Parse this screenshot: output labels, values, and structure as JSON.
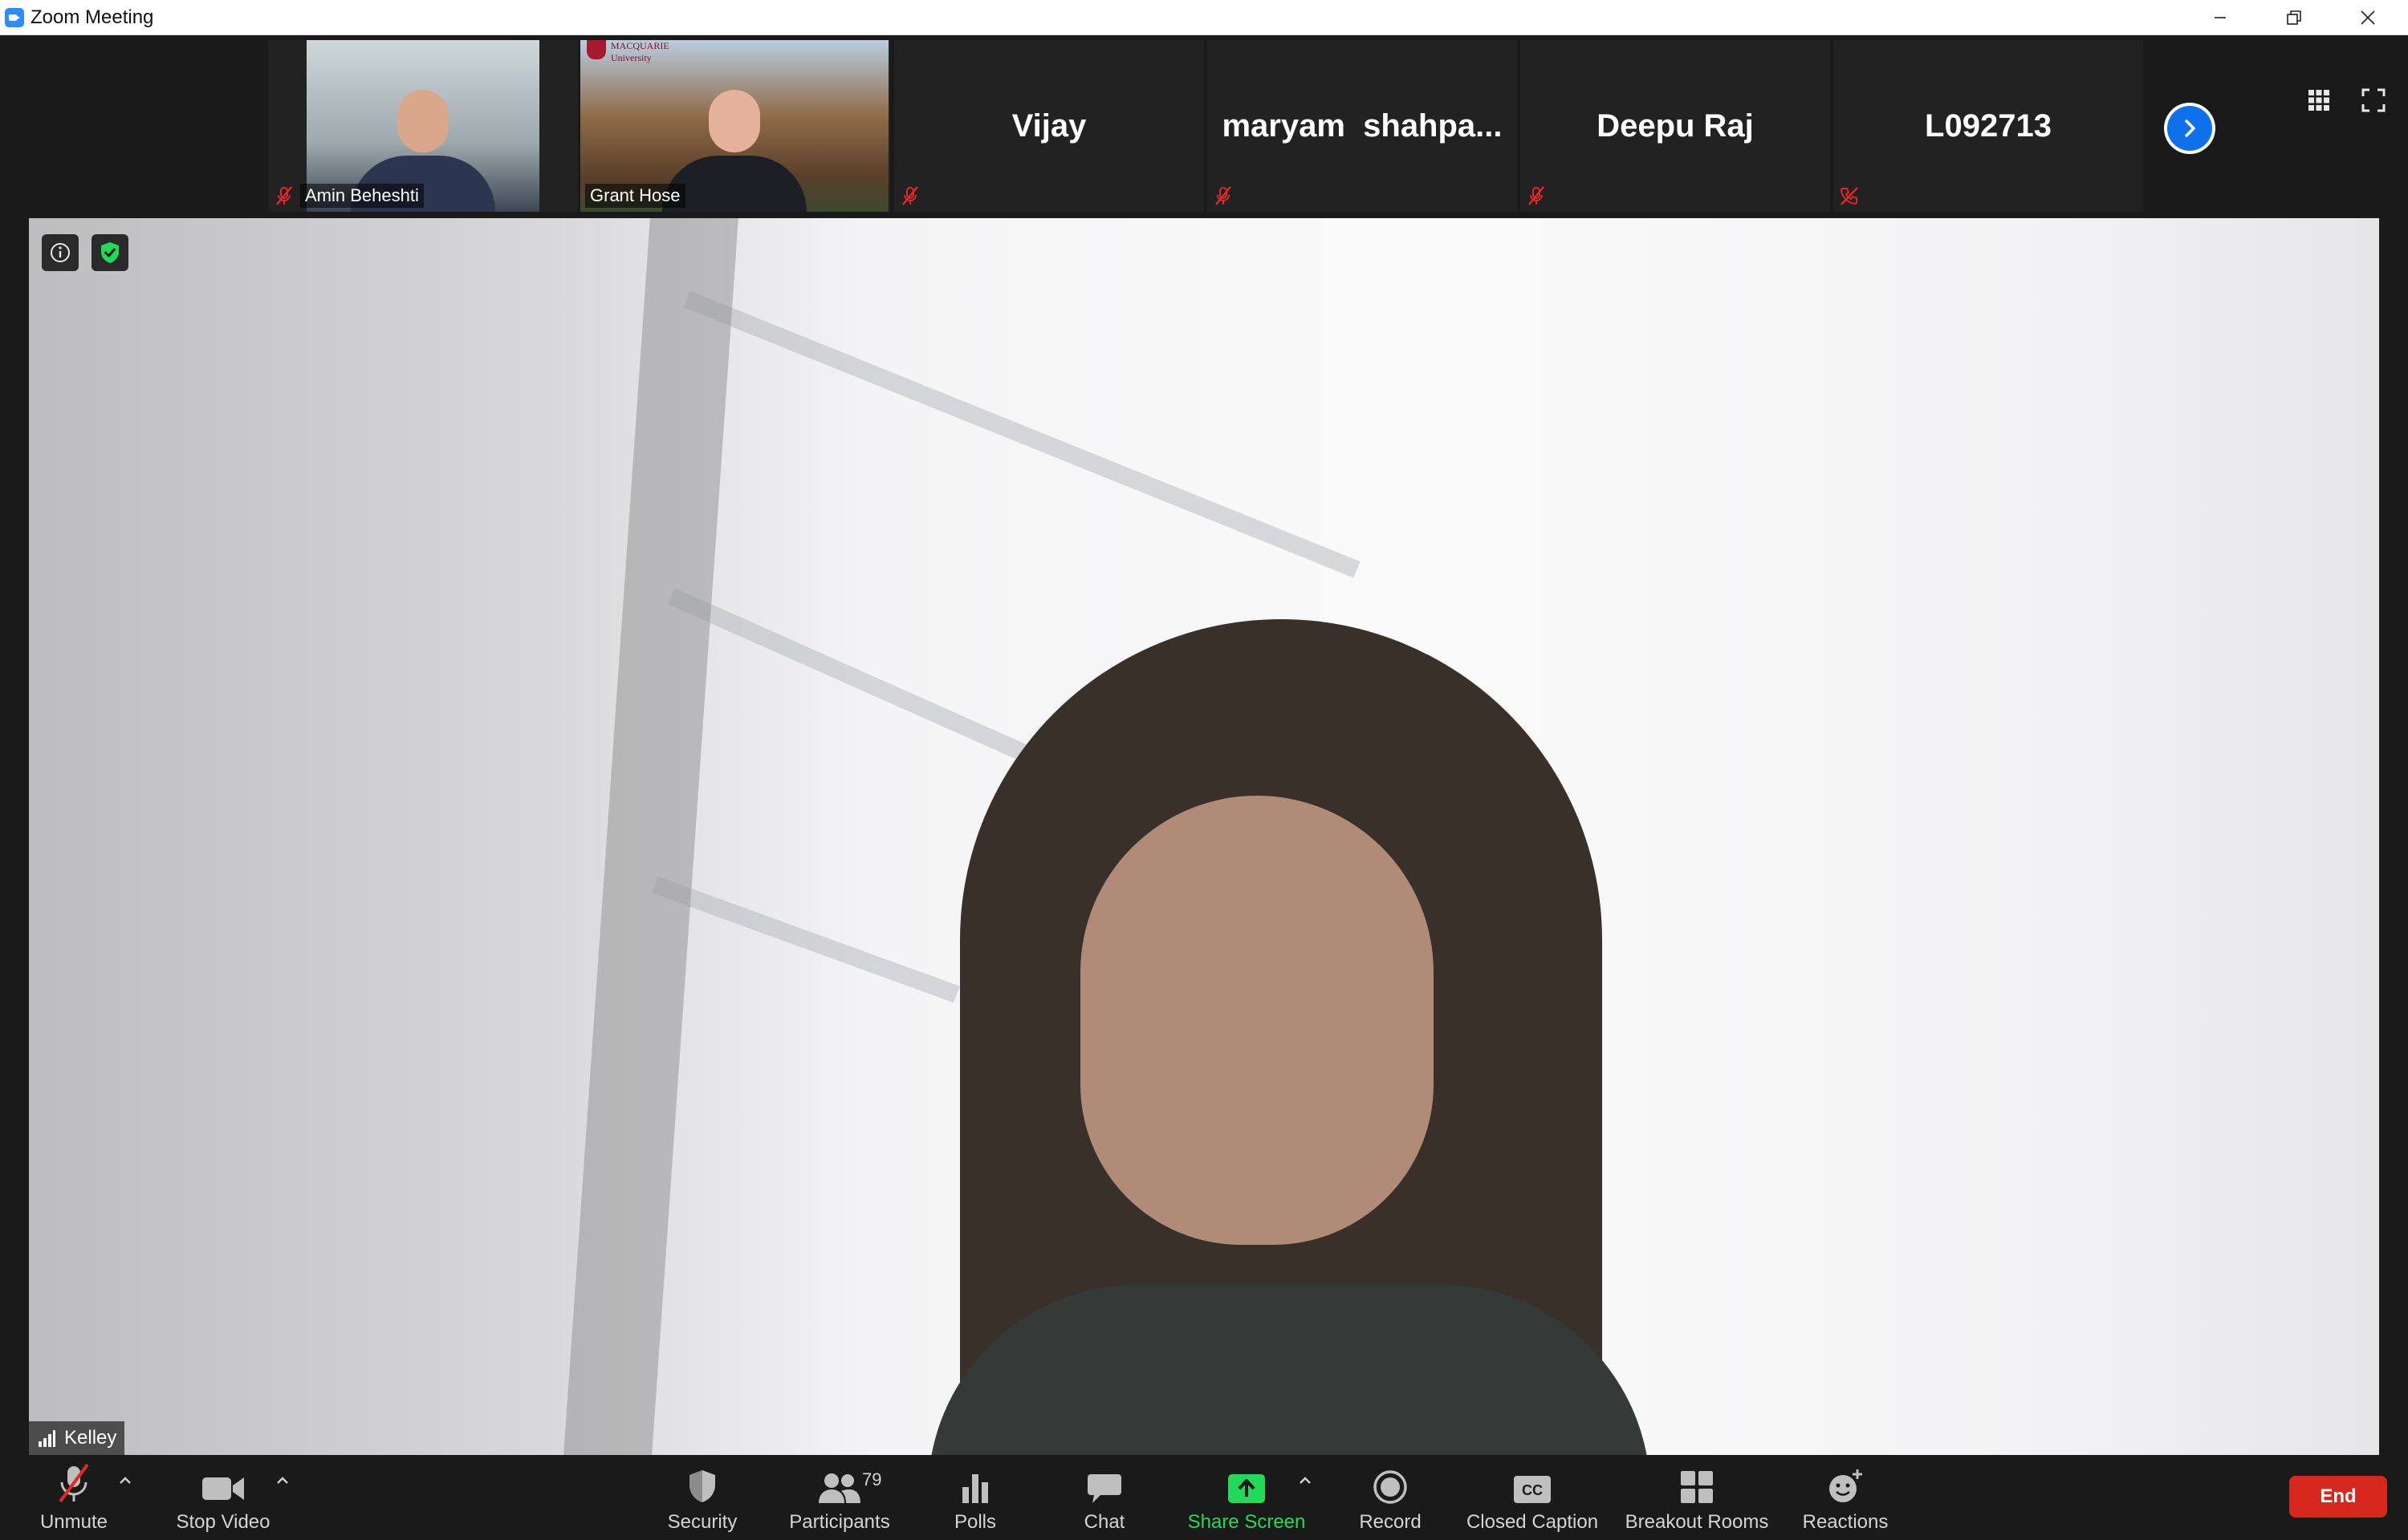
{
  "window": {
    "title": "Zoom Meeting"
  },
  "participant_strip": {
    "tiles": [
      {
        "name": "Amin Beheshti",
        "has_video": true,
        "muted": true
      },
      {
        "name": "Grant Hose",
        "has_video": true,
        "muted": true,
        "background_logo_text": "MACQUARIE University"
      },
      {
        "name": "Vijay",
        "has_video": false,
        "muted": true
      },
      {
        "name": "maryam  shahpa...",
        "has_video": false,
        "muted": true
      },
      {
        "name": "Deepu Raj",
        "has_video": false,
        "muted": true
      },
      {
        "name": "L092713",
        "has_video": false,
        "muted": true,
        "phone": true
      }
    ],
    "next_icon": "chevron-right-icon"
  },
  "main_view": {
    "active_speaker": "Kelley",
    "info_icon": "info-icon",
    "security_icon": "shield-check-icon"
  },
  "toolbar": {
    "unmute_label": "Unmute",
    "stop_video_label": "Stop Video",
    "security_label": "Security",
    "participants_label": "Participants",
    "participants_count": "79",
    "polls_label": "Polls",
    "chat_label": "Chat",
    "share_screen_label": "Share Screen",
    "record_label": "Record",
    "closed_caption_label": "Closed Caption",
    "breakout_rooms_label": "Breakout Rooms",
    "reactions_label": "Reactions",
    "end_label": "End"
  },
  "colors": {
    "accent_blue": "#0e71eb",
    "share_green": "#23d959",
    "end_red": "#d6281e",
    "mute_red": "#e02828",
    "toolbar_bg": "#1a1a1a"
  }
}
